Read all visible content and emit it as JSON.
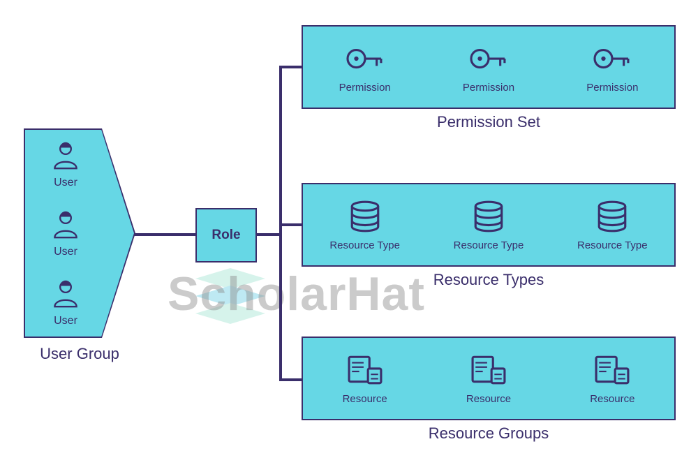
{
  "colors": {
    "fill": "#66d7e5",
    "stroke": "#3a2e6b"
  },
  "watermark": "ScholarHat",
  "userGroup": {
    "title": "User Group",
    "users": [
      {
        "label": "User"
      },
      {
        "label": "User"
      },
      {
        "label": "User"
      }
    ]
  },
  "role": {
    "label": "Role"
  },
  "permissionSet": {
    "title": "Permission Set",
    "items": [
      {
        "label": "Permission"
      },
      {
        "label": "Permission"
      },
      {
        "label": "Permission"
      }
    ]
  },
  "resourceTypes": {
    "title": "Resource Types",
    "items": [
      {
        "label": "Resource Type"
      },
      {
        "label": "Resource Type"
      },
      {
        "label": "Resource Type"
      }
    ]
  },
  "resourceGroups": {
    "title": "Resource Groups",
    "items": [
      {
        "label": "Resource"
      },
      {
        "label": "Resource"
      },
      {
        "label": "Resource"
      }
    ]
  }
}
